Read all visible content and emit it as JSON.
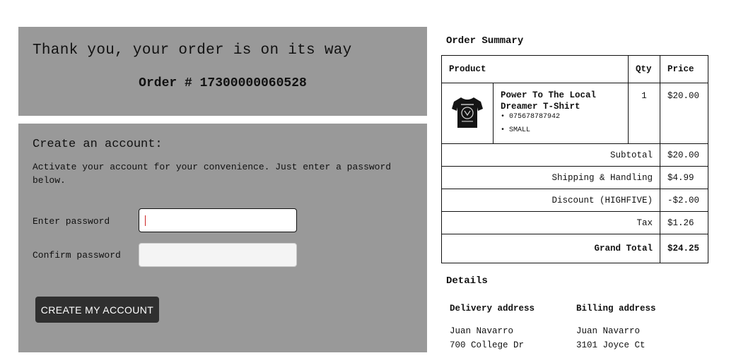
{
  "confirmation": {
    "title": "Thank you, your order is on its way",
    "order_number": "Order # 17300000060528"
  },
  "account": {
    "heading": "Create an account:",
    "description": "Activate your account for your convenience. Just enter a password below.",
    "password_label": "Enter password",
    "password_value": "",
    "confirm_label": "Confirm password",
    "confirm_value": "",
    "button_label": "CREATE MY ACCOUNT"
  },
  "summary": {
    "title": "Order Summary",
    "columns": {
      "product": "Product",
      "qty": "Qty",
      "price": "Price"
    },
    "item": {
      "name": "Power To The Local Dreamer T-Shirt",
      "sku": "075678787942",
      "size": "SMALL",
      "qty": "1",
      "price": "$20.00",
      "thumbnail_icon": "tshirt-icon"
    },
    "totals": [
      {
        "label": "Subtotal",
        "value": "$20.00"
      },
      {
        "label": "Shipping & Handling",
        "value": "$4.99"
      },
      {
        "label": "Discount (HIGHFIVE)",
        "value": "-$2.00"
      },
      {
        "label": "Tax",
        "value": "$1.26"
      }
    ],
    "grand_total": {
      "label": "Grand Total",
      "value": "$24.25"
    }
  },
  "details": {
    "title": "Details",
    "delivery": {
      "heading": "Delivery address",
      "name": "Juan Navarro",
      "street": "700 College Dr"
    },
    "billing": {
      "heading": "Billing address",
      "name": "Juan Navarro",
      "street": "3101 Joyce Ct"
    }
  },
  "colors": {
    "panel": "#999999",
    "button": "#2f2f2f",
    "caret": "#cc2222"
  }
}
